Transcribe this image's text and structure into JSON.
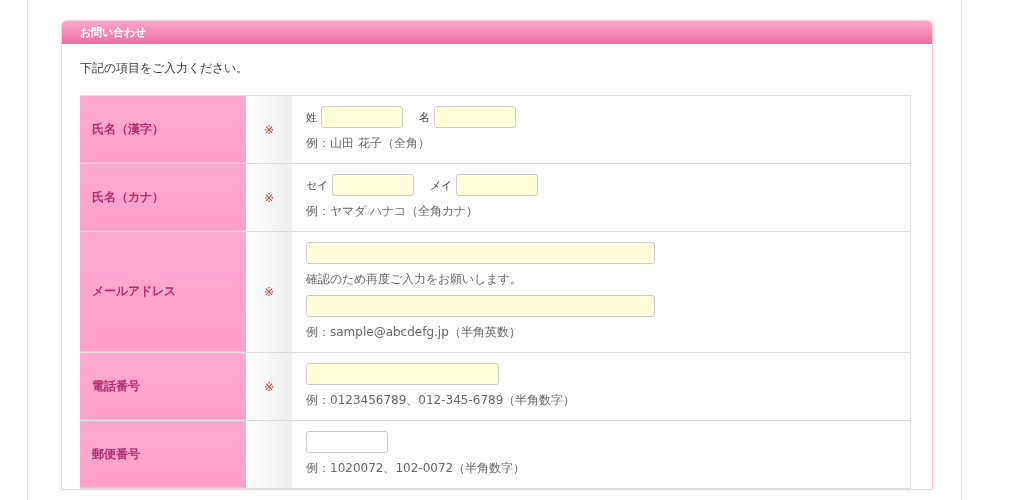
{
  "panel": {
    "title": "お問い合わせ",
    "intro": "下記の項目をご入力ください。"
  },
  "rows": [
    {
      "label": "氏名（漢字）",
      "required_mark": "※",
      "lines": [
        {
          "kind": "inputs",
          "inputs": [
            {
              "prefix": "姓",
              "kind": "short",
              "highlighted": true
            },
            {
              "prefix": "名",
              "kind": "short",
              "highlighted": true
            }
          ]
        },
        {
          "kind": "hint",
          "text": "例：山田 花子（全角）"
        }
      ]
    },
    {
      "label": "氏名（カナ）",
      "required_mark": "※",
      "lines": [
        {
          "kind": "inputs",
          "inputs": [
            {
              "prefix": "セイ",
              "kind": "short",
              "highlighted": true
            },
            {
              "prefix": "メイ",
              "kind": "short",
              "highlighted": true
            }
          ]
        },
        {
          "kind": "hint",
          "text": "例：ヤマダ ハナコ（全角カナ）"
        }
      ]
    },
    {
      "label": "メールアドレス",
      "required_mark": "※",
      "lines": [
        {
          "kind": "inputs",
          "inputs": [
            {
              "kind": "long",
              "highlighted": true
            }
          ]
        },
        {
          "kind": "note",
          "text": "確認のため再度ご入力をお願いします。"
        },
        {
          "kind": "inputs",
          "inputs": [
            {
              "kind": "long",
              "highlighted": true
            }
          ]
        },
        {
          "kind": "hint",
          "text": "例：sample@abcdefg.jp（半角英数）"
        }
      ]
    },
    {
      "label": "電話番号",
      "required_mark": "※",
      "lines": [
        {
          "kind": "inputs",
          "inputs": [
            {
              "kind": "medium",
              "highlighted": true
            }
          ]
        },
        {
          "kind": "hint",
          "text": "例：0123456789、012-345-6789（半角数字）"
        }
      ]
    },
    {
      "label": "郵便番号",
      "lines": [
        {
          "kind": "inputs",
          "inputs": [
            {
              "kind": "short",
              "highlighted": false
            }
          ]
        },
        {
          "kind": "hint",
          "text": "例：1020072、102-0072（半角数字）"
        }
      ]
    }
  ]
}
